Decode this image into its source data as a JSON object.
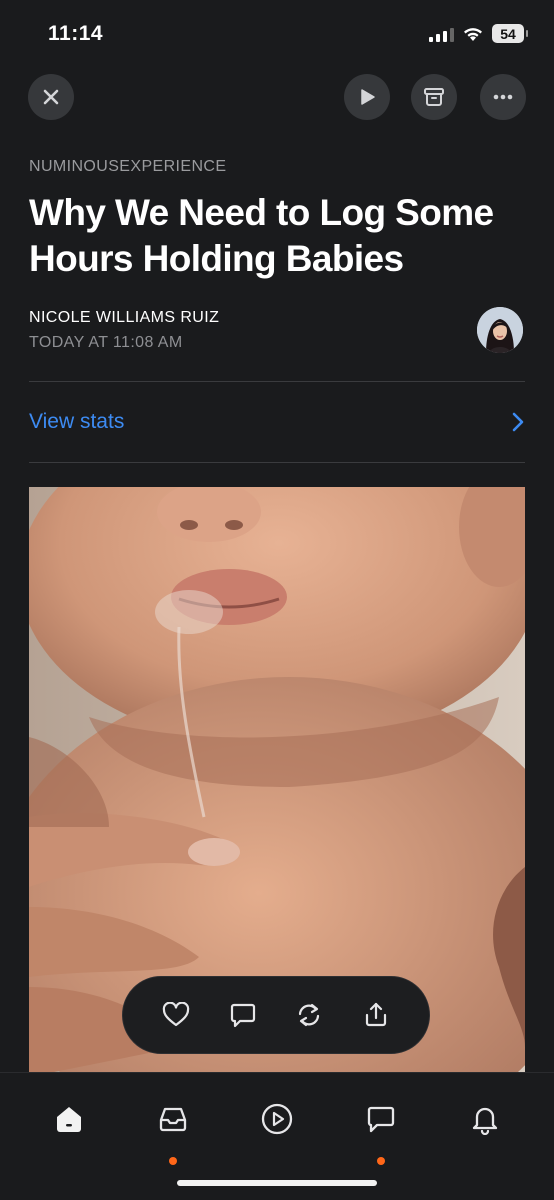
{
  "status_bar": {
    "time": "11:14",
    "battery": "54",
    "icons": [
      "cellular-signal-icon",
      "wifi-icon",
      "battery-icon"
    ]
  },
  "toolbar": {
    "close_icon": "close-icon",
    "play_icon": "play-icon",
    "archive_icon": "archive-icon",
    "more_icon": "more-icon"
  },
  "post": {
    "publication": "NUMINOUSEXPERIENCE",
    "title": "Why We Need to Log Some Hours Holding Babies",
    "author": "NICOLE WILLIAMS RUIZ",
    "date": "TODAY AT 11:08 AM"
  },
  "stats": {
    "label": "View stats"
  },
  "actions": [
    "heart-icon",
    "comment-icon",
    "restack-icon",
    "share-icon"
  ],
  "tabs": [
    {
      "name": "home",
      "icon": "home-icon",
      "active": true,
      "badge": false
    },
    {
      "name": "inbox",
      "icon": "inbox-icon",
      "active": false,
      "badge": true
    },
    {
      "name": "video",
      "icon": "play-circle-icon",
      "active": false,
      "badge": false
    },
    {
      "name": "chat",
      "icon": "chat-icon",
      "active": false,
      "badge": true
    },
    {
      "name": "notifications",
      "icon": "bell-icon",
      "active": false,
      "badge": false
    }
  ],
  "colors": {
    "background": "#1a1b1d",
    "accent_link": "#3d8bf2",
    "badge": "#ff6719",
    "button_bg": "#36383b"
  }
}
